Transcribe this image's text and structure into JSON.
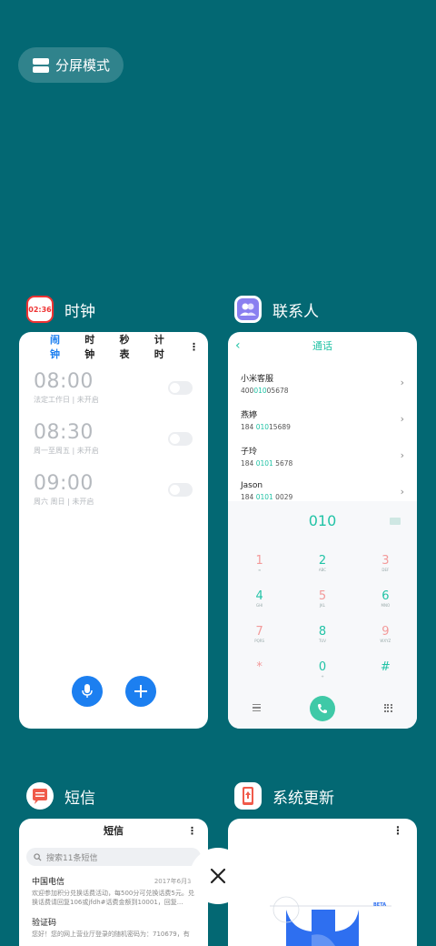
{
  "split_screen": {
    "label": "分屏模式"
  },
  "clock_app": {
    "name": "时钟",
    "icon_text": "02:36",
    "tabs": [
      "闹钟",
      "时钟",
      "秒表",
      "计时"
    ],
    "more": "⋮",
    "alarms": [
      {
        "time": "08:00",
        "desc": "法定工作日 | 未开启"
      },
      {
        "time": "08:30",
        "desc": "周一至周五 | 未开启"
      },
      {
        "time": "09:00",
        "desc": "周六 周日 | 未开启"
      }
    ]
  },
  "contacts_app": {
    "name": "联系人",
    "title": "通话",
    "contacts": [
      {
        "name": "小米客服",
        "pre": "400",
        "hl": "010",
        "post": "05678"
      },
      {
        "name": "燕婷",
        "pre": "184 ",
        "hl": "010",
        "post": "15689"
      },
      {
        "name": "子玲",
        "pre": "184 ",
        "hl": "0101",
        "post": " 5678"
      },
      {
        "name": "Jason",
        "pre": "184 ",
        "hl": "0101",
        "post": " 0029"
      }
    ],
    "dial_number": "010",
    "keys": [
      {
        "d": "1",
        "l": "∞",
        "red": true
      },
      {
        "d": "2",
        "l": "ABC",
        "red": false
      },
      {
        "d": "3",
        "l": "DEF",
        "red": true
      },
      {
        "d": "4",
        "l": "GHI",
        "red": false
      },
      {
        "d": "5",
        "l": "JKL",
        "red": true
      },
      {
        "d": "6",
        "l": "MNO",
        "red": false
      },
      {
        "d": "7",
        "l": "PQRS",
        "red": true
      },
      {
        "d": "8",
        "l": "TUV",
        "red": false
      },
      {
        "d": "9",
        "l": "WXYZ",
        "red": true
      },
      {
        "d": "*",
        "l": "",
        "red": true
      },
      {
        "d": "0",
        "l": "+",
        "red": false
      },
      {
        "d": "#",
        "l": "",
        "red": false
      }
    ]
  },
  "messages_app": {
    "name": "短信",
    "title": "短信",
    "more": "⋮",
    "search_placeholder": "搜索11条短信",
    "messages": [
      {
        "sender": "中国电信",
        "date": "2017年6月30",
        "body": "欢迎参加积分兑换话费活动，每500分可兑换话费5元。兑换话费请回复106或jfdh#话费金额到10001，回复..."
      },
      {
        "sender": "验证码",
        "date": "",
        "body": "您好！您的网上营业厅登录的随机密码为：710679，有"
      }
    ]
  },
  "update_app": {
    "name": "系统更新",
    "more": "⋮",
    "beta_label": "BETA"
  },
  "colors": {
    "background": "#036873",
    "clock_accent": "#1c7ff0",
    "contacts_accent": "#22c3a6"
  }
}
